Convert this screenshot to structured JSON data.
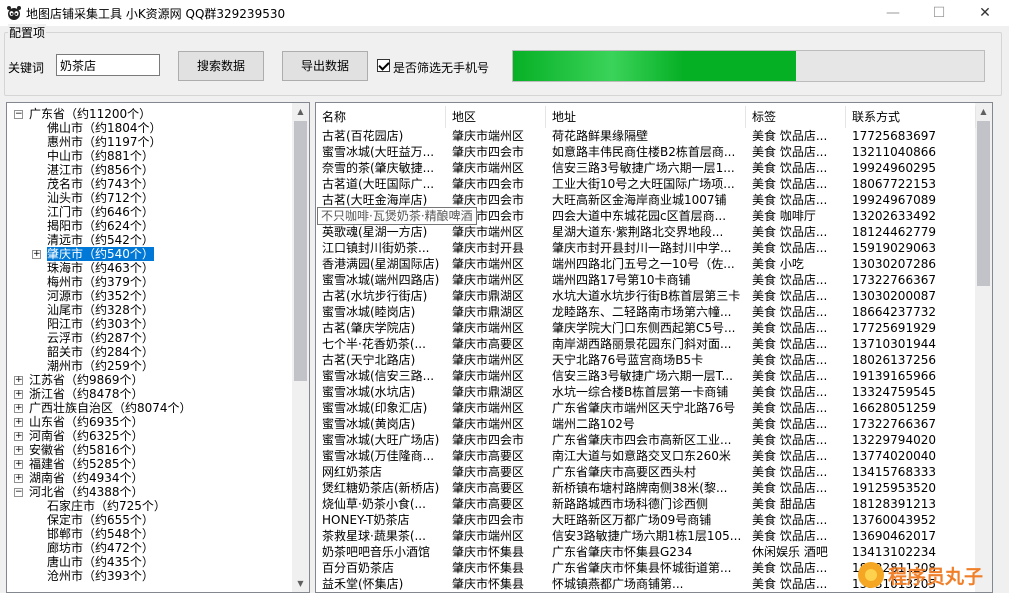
{
  "window": {
    "title": "地图店铺采集工具  小K资源网 QQ群329239530",
    "min_glyph": "—",
    "max_glyph": "☐",
    "close_glyph": "✕"
  },
  "config": {
    "group_label": "配置项",
    "keyword_label": "关键词",
    "keyword_value": "奶茶店",
    "search_button": "搜索数据",
    "export_button": "导出数据",
    "filter_checkbox_label": "是否筛选无手机号",
    "filter_checked": true,
    "progress_fraction": 0.6
  },
  "tree": {
    "collapse_glyph": "−",
    "expand_glyph": "+",
    "nodes": [
      {
        "label": "广东省（约11200个）",
        "level": 0,
        "expanded": true
      },
      {
        "label": "佛山市（约1804个）",
        "level": 1
      },
      {
        "label": "惠州市（约1197个）",
        "level": 1
      },
      {
        "label": "中山市（约881个）",
        "level": 1
      },
      {
        "label": "湛江市（约856个）",
        "level": 1
      },
      {
        "label": "茂名市（约743个）",
        "level": 1
      },
      {
        "label": "汕头市（约712个）",
        "level": 1
      },
      {
        "label": "江门市（约646个）",
        "level": 1
      },
      {
        "label": "揭阳市（约624个）",
        "level": 1
      },
      {
        "label": "清远市（约542个）",
        "level": 1
      },
      {
        "label": "肇庆市（约540个）",
        "level": 1,
        "selected": true,
        "has_children": true
      },
      {
        "label": "珠海市（约463个）",
        "level": 1
      },
      {
        "label": "梅州市（约379个）",
        "level": 1
      },
      {
        "label": "河源市（约352个）",
        "level": 1
      },
      {
        "label": "汕尾市（约328个）",
        "level": 1
      },
      {
        "label": "阳江市（约303个）",
        "level": 1
      },
      {
        "label": "云浮市（约287个）",
        "level": 1
      },
      {
        "label": "韶关市（约284个）",
        "level": 1
      },
      {
        "label": "潮州市（约259个）",
        "level": 1
      },
      {
        "label": "江苏省（约9869个）",
        "level": 0,
        "expanded": false
      },
      {
        "label": "浙江省（约8478个）",
        "level": 0,
        "expanded": false
      },
      {
        "label": "广西壮族自治区（约8074个）",
        "level": 0,
        "expanded": false
      },
      {
        "label": "山东省（约6935个）",
        "level": 0,
        "expanded": false
      },
      {
        "label": "河南省（约6325个）",
        "level": 0,
        "expanded": false
      },
      {
        "label": "安徽省（约5816个）",
        "level": 0,
        "expanded": false
      },
      {
        "label": "福建省（约5285个）",
        "level": 0,
        "expanded": false
      },
      {
        "label": "湖南省（约4934个）",
        "level": 0,
        "expanded": false
      },
      {
        "label": "河北省（约4388个）",
        "level": 0,
        "expanded": true
      },
      {
        "label": "石家庄市（约725个）",
        "level": 1
      },
      {
        "label": "保定市（约655个）",
        "level": 1
      },
      {
        "label": "邯郸市（约548个）",
        "level": 1
      },
      {
        "label": "廊坊市（约472个）",
        "level": 1
      },
      {
        "label": "唐山市（约435个）",
        "level": 1
      },
      {
        "label": "沧州市（约393个）",
        "level": 1
      }
    ]
  },
  "table": {
    "columns": [
      "名称",
      "地区",
      "地址",
      "标签",
      "联系方式"
    ],
    "rows": [
      [
        "古茗(百花园店)",
        "肇庆市端州区",
        "荷花路鲜果缘隔壁",
        "美食 饮品店...",
        "17725683697"
      ],
      [
        "蜜雪冰城(大旺益万...",
        "肇庆市四会市",
        "如意路丰伟民商住楼B2栋首层商...",
        "美食 饮品店...",
        "13211040866"
      ],
      [
        "奈雪的茶(肇庆敏捷...",
        "肇庆市端州区",
        "信安三路3号敏捷广场六期一层1...",
        "美食 饮品店...",
        "19924960295"
      ],
      [
        "古茗道(大旺国际广...",
        "肇庆市四会市",
        "工业大街10号之大旺国际广场项...",
        "美食 饮品店...",
        "18067722153"
      ],
      [
        "古茗(大旺金海岸店)",
        "肇庆市四会市",
        "大旺高新区金海岸商业城1007铺",
        "美食 饮品店...",
        "19924967089"
      ],
      [
        "不只咖啡·瓦煲奶茶...",
        "肇庆市四会市",
        "四会大道中东城花园c区首层商...",
        "美食 咖啡厅",
        "13202633492"
      ],
      [
        "英歌魂(星湖一方店)",
        "肇庆市端州区",
        "星湖大道东·紫荆路北交界地段...",
        "美食 饮品店...",
        "18124462779"
      ],
      [
        "江口镇封川街奶茶...",
        "肇庆市封开县",
        "肇庆市封开县封川一路封川中学...",
        "美食 饮品店...",
        "15919029063"
      ],
      [
        "香港满园(星湖国际店)",
        "肇庆市端州区",
        "端州四路北门五号之一10号（佐...",
        "美食 小吃",
        "13030207286"
      ],
      [
        "蜜雪冰城(端州四路店)",
        "肇庆市端州区",
        "端州四路17号第10卡商铺",
        "美食 饮品店...",
        "17322766367"
      ],
      [
        "古茗(水坑步行街店)",
        "肇庆市鼎湖区",
        "水坑大道水坑步行街B栋首层第三卡",
        "美食 饮品店...",
        "13030200087"
      ],
      [
        "蜜雪冰城(睦岗店)",
        "肇庆市鼎湖区",
        "龙睦路东、二轻路南市场第六幢...",
        "美食 饮品店...",
        "18664237732"
      ],
      [
        "古茗(肇庆学院店)",
        "肇庆市端州区",
        "肇庆学院大门口东侧西起第C5号...",
        "美食 饮品店...",
        "17725691929"
      ],
      [
        "七个半·花香奶茶(...",
        "肇庆市高要区",
        "南岸湖西路丽景花园东门斜对面...",
        "美食 饮品店...",
        "13710301944"
      ],
      [
        "古茗(天宁北路店)",
        "肇庆市端州区",
        "天宁北路76号蓝宫商场B5卡",
        "美食 饮品店...",
        "18026137256"
      ],
      [
        "蜜雪冰城(信安三路...",
        "肇庆市端州区",
        "信安三路3号敏捷广场六期一层T...",
        "美食 饮品店...",
        "19139165966"
      ],
      [
        "蜜雪冰城(水坑店)",
        "肇庆市鼎湖区",
        "水坑一综合楼B栋首层第一卡商铺",
        "美食 饮品店...",
        "13324759545"
      ],
      [
        "蜜雪冰城(印象汇店)",
        "肇庆市端州区",
        "广东省肇庆市端州区天宁北路76号",
        "美食 饮品店...",
        "16628051259"
      ],
      [
        "蜜雪冰城(黄岗店)",
        "肇庆市端州区",
        "端州二路102号",
        "美食 饮品店...",
        "17322766367"
      ],
      [
        "蜜雪冰城(大旺广场店)",
        "肇庆市四会市",
        "广东省肇庆市四会市高新区工业...",
        "美食 饮品店...",
        "13229794020"
      ],
      [
        "蜜雪冰城(万佳隆商...",
        "肇庆市高要区",
        "南江大道与如意路交叉口东260米",
        "美食 饮品店...",
        "13774020040"
      ],
      [
        "网红奶茶店",
        "肇庆市高要区",
        "广东省肇庆市高要区西头村",
        "美食 饮品店...",
        "13415768333"
      ],
      [
        "煲红糖奶茶店(新桥店)",
        "肇庆市高要区",
        "新桥镇布塘村路牌南侧38米(黎...",
        "美食 饮品店...",
        "19125953520"
      ],
      [
        "烧仙草·奶茶小食(...",
        "肇庆市高要区",
        "新路路城西市场科德门诊西侧",
        "美食 甜品店",
        "18128391213"
      ],
      [
        "HONEY-T奶茶店",
        "肇庆市四会市",
        "大旺路新区万都广场09号商铺",
        "美食 饮品店...",
        "13760043952"
      ],
      [
        "茶救星球·蔬果茶(...",
        "肇庆市端州区",
        "信安3路敏捷广场六期1栋1层105...",
        "美食 饮品店...",
        "13690462017"
      ],
      [
        "奶茶吧吧音乐小酒馆",
        "肇庆市怀集县",
        "广东省肇庆市怀集县G234",
        "休闲娱乐 酒吧",
        "13413102234"
      ],
      [
        "百分百奶茶店",
        "肇庆市怀集县",
        "广东省肇庆市怀集县怀城街道第...",
        "美食 饮品店...",
        "18322811208"
      ],
      [
        "益禾堂(怀集店)",
        "肇庆市怀集县",
        "怀城镇燕都广场商铺第...",
        "美食 饮品店...",
        "13531013205"
      ]
    ],
    "tooltip": "不只咖啡·瓦煲奶茶·精酿啤酒"
  },
  "watermark": {
    "text": "程序员丸子"
  }
}
